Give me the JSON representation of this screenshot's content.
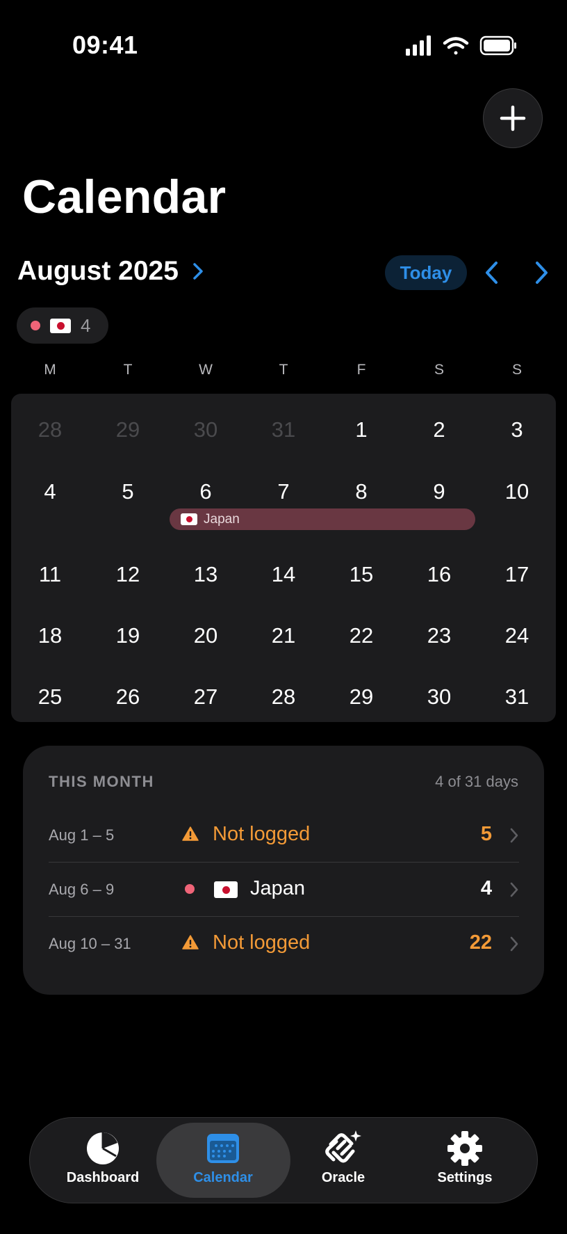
{
  "status_bar": {
    "time": "09:41"
  },
  "header": {
    "title": "Calendar",
    "add_icon": "plus-icon"
  },
  "month_nav": {
    "month_label": "August 2025",
    "today_label": "Today"
  },
  "filter_chip": {
    "count": "4",
    "flag": "japan-flag-icon",
    "dot_color": "#ef6478"
  },
  "weekdays": [
    "M",
    "T",
    "W",
    "T",
    "F",
    "S",
    "S"
  ],
  "calendar": {
    "weeks": [
      [
        "28",
        "29",
        "30",
        "31",
        "1",
        "2",
        "3"
      ],
      [
        "4",
        "5",
        "6",
        "7",
        "8",
        "9",
        "10"
      ],
      [
        "11",
        "12",
        "13",
        "14",
        "15",
        "16",
        "17"
      ],
      [
        "18",
        "19",
        "20",
        "21",
        "22",
        "23",
        "24"
      ],
      [
        "25",
        "26",
        "27",
        "28",
        "29",
        "30",
        "31"
      ]
    ],
    "event": {
      "label": "Japan",
      "color": "#693742",
      "start": "Aug 6",
      "end": "Aug 9"
    }
  },
  "this_month": {
    "title": "THIS MONTH",
    "summary": "4 of 31 days",
    "rows": [
      {
        "range": "Aug 1 – 5",
        "label": "Not logged",
        "count": "5",
        "status": "warning"
      },
      {
        "range": "Aug 6 – 9",
        "label": "Japan",
        "count": "4",
        "status": "trip"
      },
      {
        "range": "Aug 10 – 31",
        "label": "Not logged",
        "count": "22",
        "status": "warning"
      }
    ]
  },
  "colors": {
    "accent": "#2e8fe8",
    "warning": "#f39a37",
    "trip_dot": "#ef6478"
  },
  "tabs": [
    {
      "label": "Dashboard",
      "icon": "pie-chart-icon",
      "active": false
    },
    {
      "label": "Calendar",
      "icon": "calendar-icon",
      "active": true
    },
    {
      "label": "Oracle",
      "icon": "oracle-sparkle-icon",
      "active": false
    },
    {
      "label": "Settings",
      "icon": "gear-icon",
      "active": false
    }
  ]
}
